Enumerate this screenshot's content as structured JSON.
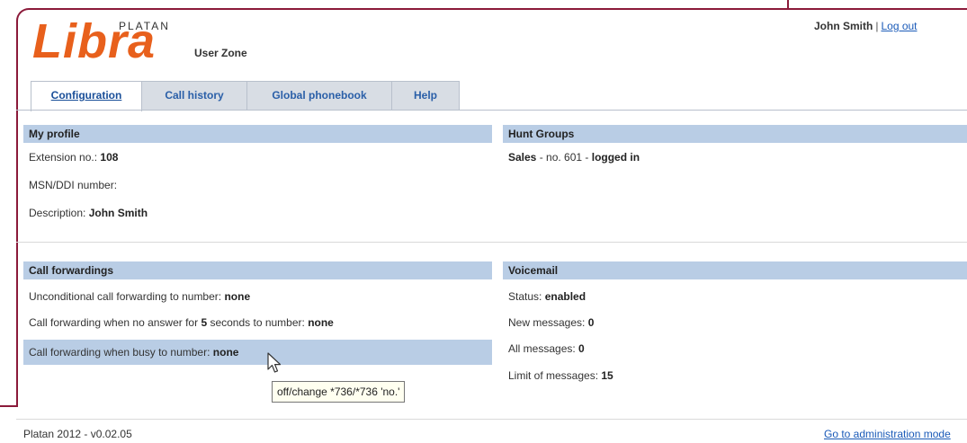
{
  "header": {
    "brand_top": "PLATAN",
    "brand_name": "Libra",
    "brand_sub": "User Zone",
    "user_name": "John Smith",
    "separator": "|",
    "logout": "Log out"
  },
  "tabs": [
    {
      "label": "Configuration",
      "active": true
    },
    {
      "label": "Call history",
      "active": false
    },
    {
      "label": "Global phonebook",
      "active": false
    },
    {
      "label": "Help",
      "active": false
    }
  ],
  "my_profile": {
    "title": "My profile",
    "extension_label": "Extension no.: ",
    "extension_value": "108",
    "msn_label": "MSN/DDI number:",
    "description_label": "Description: ",
    "description_value": "John Smith"
  },
  "hunt_groups": {
    "title": "Hunt Groups",
    "group_name": "Sales",
    "group_mid": " - no. 601 - ",
    "group_status": "logged in"
  },
  "call_forwardings": {
    "title": "Call forwardings",
    "unconditional_label": "Unconditional call forwarding to number: ",
    "unconditional_value": "none",
    "noanswer_label_a": "Call forwarding when no answer for ",
    "noanswer_seconds": "5",
    "noanswer_label_b": " seconds to number: ",
    "noanswer_value": "none",
    "busy_label": "Call forwarding when busy to number: ",
    "busy_value": "none"
  },
  "voicemail": {
    "title": "Voicemail",
    "status_label": "Status: ",
    "status_value": "enabled",
    "new_label": "New messages: ",
    "new_value": "0",
    "all_label": "All messages: ",
    "all_value": "0",
    "limit_label": "Limit of messages: ",
    "limit_value": "15"
  },
  "tooltip": "off/change *736/*736 'no.'",
  "footer": {
    "version": "Platan 2012 - v0.02.05",
    "admin_link": "Go to administration mode"
  },
  "colors": {
    "brand": "#e8601c",
    "section_header": "#b9cde5",
    "link": "#1a5ab8",
    "frame": "#8b1a3a"
  }
}
